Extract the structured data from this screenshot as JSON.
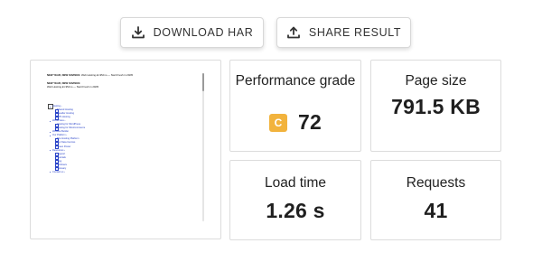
{
  "toolbar": {
    "download_label": "DOWNLOAD HAR",
    "share_label": "SHARE RESULT"
  },
  "preview": {
    "lines": [
      {
        "bold": "NEW YEAR, NEW SAVINGS:",
        "text": " Web Hosting £1.95/mo — Start Fresh in 2026!"
      },
      {
        "bold": "NEW YEAR, NEW SAVINGS:",
        "text": ""
      },
      {
        "bold": "",
        "text": "Web Hosting £1.95/mo — Start Fresh in 2026!"
      }
    ],
    "menu": [
      {
        "level": 0,
        "text": "Hosting ›"
      },
      {
        "level": 1,
        "text": "Shared Hosting"
      },
      {
        "level": 1,
        "text": "Reseller Hosting"
      },
      {
        "level": 1,
        "text": "VPS Hosting"
      },
      {
        "level": 0,
        "text": "WordPress ›"
      },
      {
        "level": 1,
        "text": "Hosting for WordPress"
      },
      {
        "level": 1,
        "text": "Hosting for WooCommerce"
      },
      {
        "level": 0,
        "text": "Website Builder"
      },
      {
        "level": 0,
        "text": "Our Platform ›"
      },
      {
        "level": 1,
        "text": "The Hosting Platform"
      },
      {
        "level": 1,
        "text": "Our Data Centres"
      },
      {
        "level": 1,
        "text": "Green Power"
      },
      {
        "level": 0,
        "text": "Resources ›"
      },
      {
        "level": 1,
        "text": "Support"
      },
      {
        "level": 1,
        "text": "Tutorials"
      },
      {
        "level": 1,
        "text": "Blog"
      },
      {
        "level": 1,
        "text": "Webinars"
      },
      {
        "level": 1,
        "text": "Glossary"
      },
      {
        "level": 0,
        "text": "Contact us ›"
      }
    ]
  },
  "stats": {
    "performance": {
      "label": "Performance grade",
      "grade": "C",
      "score": "72",
      "grade_color": "#f2b33d"
    },
    "page_size": {
      "label": "Page size",
      "value": "791.5 KB"
    },
    "load_time": {
      "label": "Load time",
      "value": "1.26 s"
    },
    "requests": {
      "label": "Requests",
      "value": "41"
    }
  }
}
